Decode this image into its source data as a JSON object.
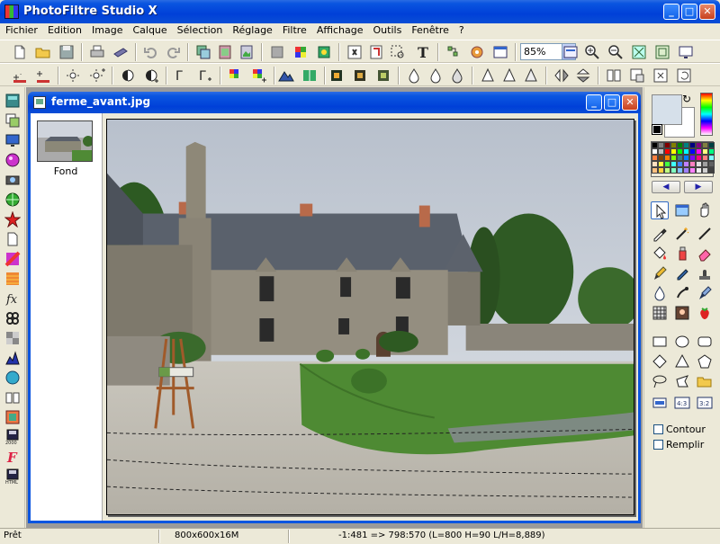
{
  "app": {
    "title": "PhotoFiltre Studio X",
    "window_buttons": {
      "minimize": "_",
      "maximize": "□",
      "close": "✕"
    }
  },
  "menu": [
    "Fichier",
    "Edition",
    "Image",
    "Calque",
    "Sélection",
    "Réglage",
    "Filtre",
    "Affichage",
    "Outils",
    "Fenêtre",
    "?"
  ],
  "toolbar": {
    "zoom_value": "85%"
  },
  "document": {
    "title": "ferme_avant.jpg",
    "window_buttons": {
      "minimize": "_",
      "maximize": "□",
      "close": "✕"
    },
    "layers": [
      {
        "label": "Fond"
      }
    ]
  },
  "right_panel": {
    "options": [
      {
        "label": "Contour",
        "checked": false
      },
      {
        "label": "Remplir",
        "checked": false
      }
    ],
    "palette_prev": "◀",
    "palette_next": "▶",
    "swap_glyph": "↻",
    "palette_colors": [
      "#000000",
      "#808080",
      "#800000",
      "#808000",
      "#008000",
      "#008080",
      "#000080",
      "#800080",
      "#808040",
      "#004040",
      "#ffffff",
      "#c0c0c0",
      "#ff0000",
      "#ffff00",
      "#00ff00",
      "#00ffff",
      "#0000ff",
      "#ff00ff",
      "#ffff80",
      "#00ff80",
      "#ff8040",
      "#804000",
      "#ff8000",
      "#80ff00",
      "#408080",
      "#0080ff",
      "#8000ff",
      "#ff0080",
      "#ff8080",
      "#80ffff",
      "#ffe0c0",
      "#ffff40",
      "#40ff40",
      "#40ffff",
      "#4080ff",
      "#c080ff",
      "#ff80c0",
      "#e0e0e0",
      "#a0a0a0",
      "#606060",
      "#ffc080",
      "#ffd040",
      "#c0ff80",
      "#80ffc0",
      "#80c0ff",
      "#a080ff",
      "#ff80ff",
      "#f0f0f0",
      "#d0d0d0",
      "#404040"
    ],
    "foreground_color": "#d6e0ea",
    "background_color": "#ffffff"
  },
  "status": {
    "state": "Prêt",
    "image_info": "800x600x16M",
    "coords": "-1:481 => 798:570 (L=800  H=90  L/H=8,889)"
  }
}
